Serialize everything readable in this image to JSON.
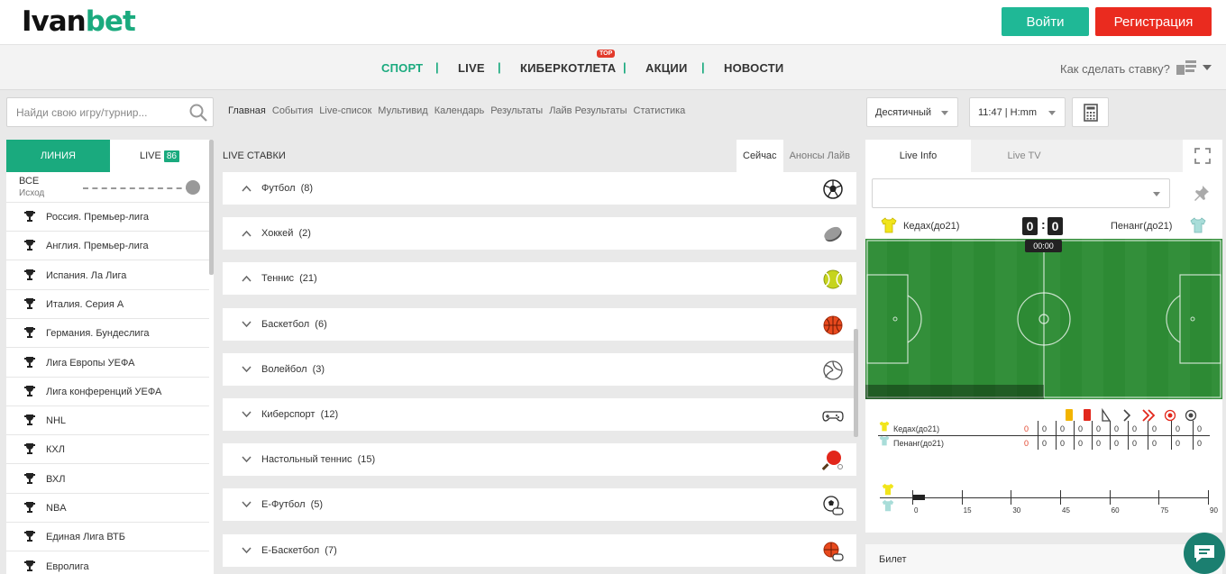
{
  "header": {
    "logo_part1": "Ivan",
    "logo_part2": "bet",
    "login_label": "Войти",
    "register_label": "Регистрация"
  },
  "nav": {
    "items": [
      "СПОРТ",
      "LIVE",
      "КИБЕРКОТЛЕТА",
      "АКЦИИ",
      "НОВОСТИ"
    ],
    "separator": "|",
    "top_badge": "TOP",
    "howto": "Как сделать ставку?"
  },
  "search": {
    "placeholder": "Найди свою игру/турнир..."
  },
  "sublinks": [
    "Главная",
    "События",
    "Live-список",
    "Мультивид",
    "Календарь",
    "Результаты",
    "Лайв Результаты",
    "Статистика"
  ],
  "selectors": {
    "odds_format": "Десятичный",
    "time_format": "11:47 | H:mm"
  },
  "left_panel": {
    "tab_line": "ЛИНИЯ",
    "tab_live": "LIVE",
    "live_count": "86",
    "all_label": "ВСЕ",
    "outcome_label": "Исход",
    "leagues": [
      "Россия. Премьер-лига",
      "Англия. Премьер-лига",
      "Испания. Ла Лига",
      "Италия. Серия А",
      "Германия. Бундеслига",
      "Лига Европы УЕФА",
      "Лига конференций УЕФА",
      "NHL",
      "КХЛ",
      "ВХЛ",
      "NBA",
      "Единая Лига ВТБ",
      "Евролига"
    ]
  },
  "center": {
    "title": "LIVE СТАВКИ",
    "tab_now": "Сейчас",
    "tab_announce": "Анонсы Лайв",
    "sports": [
      {
        "name": "Футбол",
        "count": "(8)",
        "icon": "football-icon",
        "expanded": true
      },
      {
        "name": "Хоккей",
        "count": "(2)",
        "icon": "hockey-puck-icon",
        "expanded": true
      },
      {
        "name": "Теннис",
        "count": "(21)",
        "icon": "tennis-ball-icon",
        "expanded": true
      },
      {
        "name": "Баскетбол",
        "count": "(6)",
        "icon": "basketball-icon",
        "expanded": false
      },
      {
        "name": "Волейбол",
        "count": "(3)",
        "icon": "volleyball-icon",
        "expanded": false
      },
      {
        "name": "Киберспорт",
        "count": "(12)",
        "icon": "gamepad-icon",
        "expanded": false
      },
      {
        "name": "Настольный теннис",
        "count": "(15)",
        "icon": "table-tennis-icon",
        "expanded": false
      },
      {
        "name": "E-Футбол",
        "count": "(5)",
        "icon": "e-football-icon",
        "expanded": false
      },
      {
        "name": "E-Баскетбол",
        "count": "(7)",
        "icon": "e-basketball-icon",
        "expanded": false
      }
    ]
  },
  "right_panel": {
    "tab_info": "Live Info",
    "tab_tv": "Live TV",
    "home_team": "Кедах(до21)",
    "away_team": "Пенанг(до21)",
    "home_score": "0",
    "away_score": "0",
    "score_sep": ":",
    "timer": "00:00",
    "home_stats": [
      "0",
      "0",
      "0",
      "0",
      "0",
      "0",
      "0",
      "0",
      "0",
      "0"
    ],
    "away_stats": [
      "0",
      "0",
      "0",
      "0",
      "0",
      "0",
      "0",
      "0",
      "0",
      "0"
    ],
    "timeline_labels": [
      "0",
      "15",
      "30",
      "45",
      "60",
      "75",
      "90"
    ],
    "colors": {
      "yellow_card": "#f2b400",
      "red_card": "#e2271b",
      "field_green": "#2d8a34"
    }
  },
  "bilet": {
    "label": "Билет"
  }
}
